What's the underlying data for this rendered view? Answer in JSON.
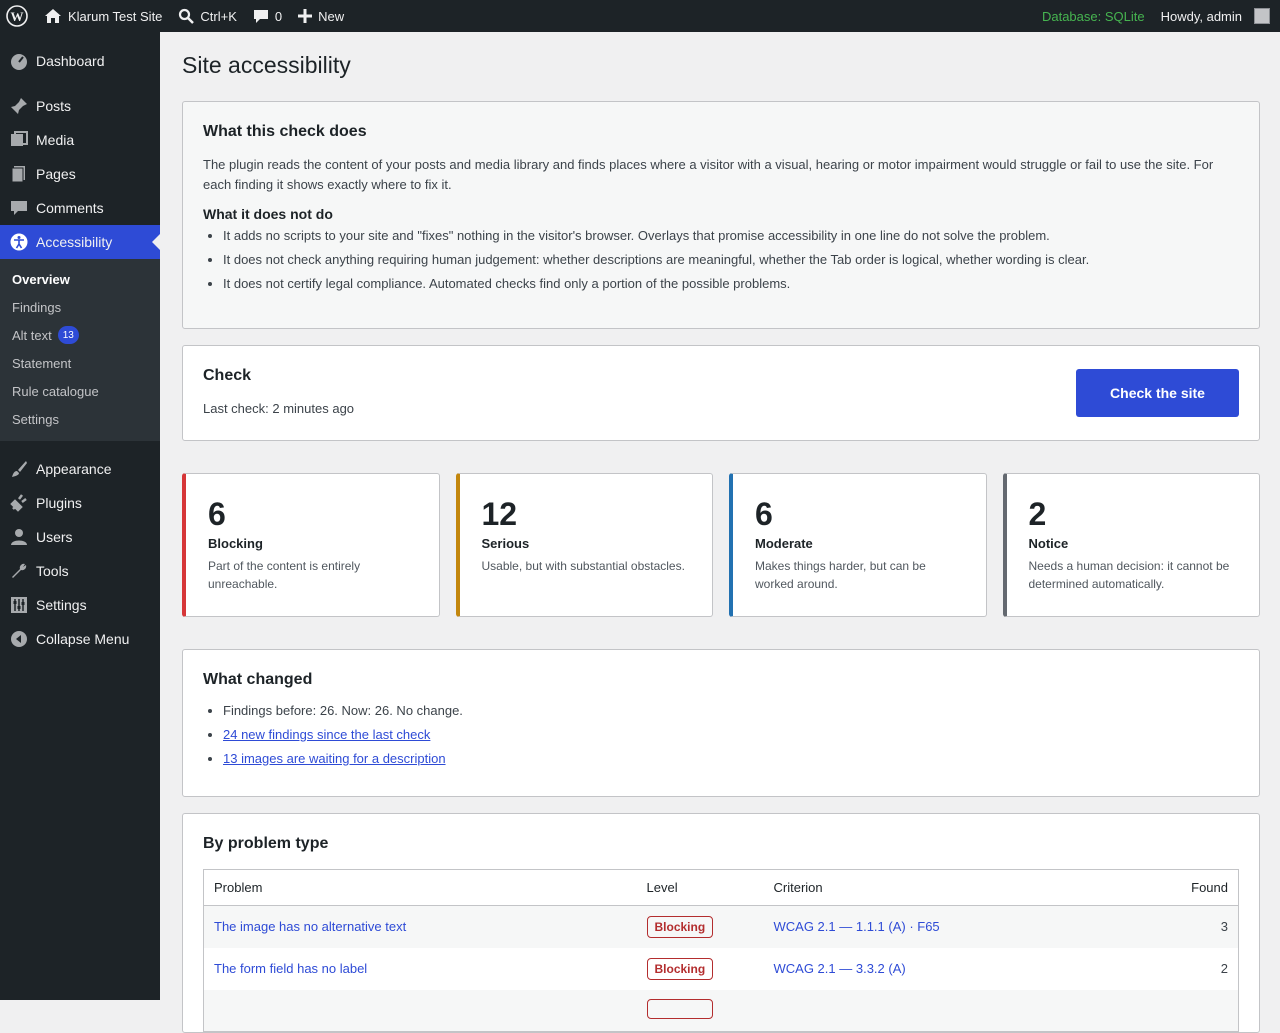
{
  "adminbar": {
    "site": "Klarum Test Site",
    "search": "Ctrl+K",
    "comments": "0",
    "new": "New",
    "database": "Database: SQLite",
    "howdy": "Howdy, admin"
  },
  "sidebar": {
    "items": [
      "Dashboard",
      "Posts",
      "Media",
      "Pages",
      "Comments",
      "Accessibility",
      "Appearance",
      "Plugins",
      "Users",
      "Tools",
      "Settings",
      "Collapse Menu"
    ],
    "submenu": [
      {
        "label": "Overview"
      },
      {
        "label": "Findings"
      },
      {
        "label": "Alt text",
        "count": "13"
      },
      {
        "label": "Statement"
      },
      {
        "label": "Rule catalogue"
      },
      {
        "label": "Settings"
      }
    ]
  },
  "page": {
    "title": "Site accessibility"
  },
  "about": {
    "title": "What this check does",
    "text": "The plugin reads the content of your posts and media library and finds places where a visitor with a visual, hearing or motor impairment would struggle or fail to use the site. For each finding it shows exactly where to fix it.",
    "not_title": "What it does not do",
    "bullets": [
      "It adds no scripts to your site and \"fixes\" nothing in the visitor's browser. Overlays that promise accessibility in one line do not solve the problem.",
      "It does not check anything requiring human judgement: whether descriptions are meaningful, whether the Tab order is logical, whether wording is clear.",
      "It does not certify legal compliance. Automated checks find only a portion of the possible problems."
    ]
  },
  "check": {
    "title": "Check",
    "last": "Last check: 2 minutes ago",
    "button": "Check the site"
  },
  "stats": [
    {
      "num": "6",
      "label": "Blocking",
      "desc": "Part of the content is entirely unreachable.",
      "color": "#d63638"
    },
    {
      "num": "12",
      "label": "Serious",
      "desc": "Usable, but with substantial obstacles.",
      "color": "#c3870e"
    },
    {
      "num": "6",
      "label": "Moderate",
      "desc": "Makes things harder, but can be worked around.",
      "color": "#2271b1"
    },
    {
      "num": "2",
      "label": "Notice",
      "desc": "Needs a human decision: it cannot be determined automatically.",
      "color": "#646970"
    }
  ],
  "changes": {
    "title": "What changed",
    "summary": "Findings before: 26. Now: 26. No change.",
    "link1": "24 new findings since the last check",
    "link2": "13 images are waiting for a description"
  },
  "bytype": {
    "title": "By problem type",
    "headers": [
      "Problem",
      "Level",
      "Criterion",
      "Found"
    ],
    "rows": [
      {
        "problem": "The image has no alternative text",
        "level": "Blocking",
        "criterion": "WCAG 2.1 — 1.1.1 (A) · F65",
        "found": "3"
      },
      {
        "problem": "The form field has no label",
        "level": "Blocking",
        "criterion": "WCAG 2.1 — 3.3.2 (A)",
        "found": "2"
      }
    ]
  }
}
